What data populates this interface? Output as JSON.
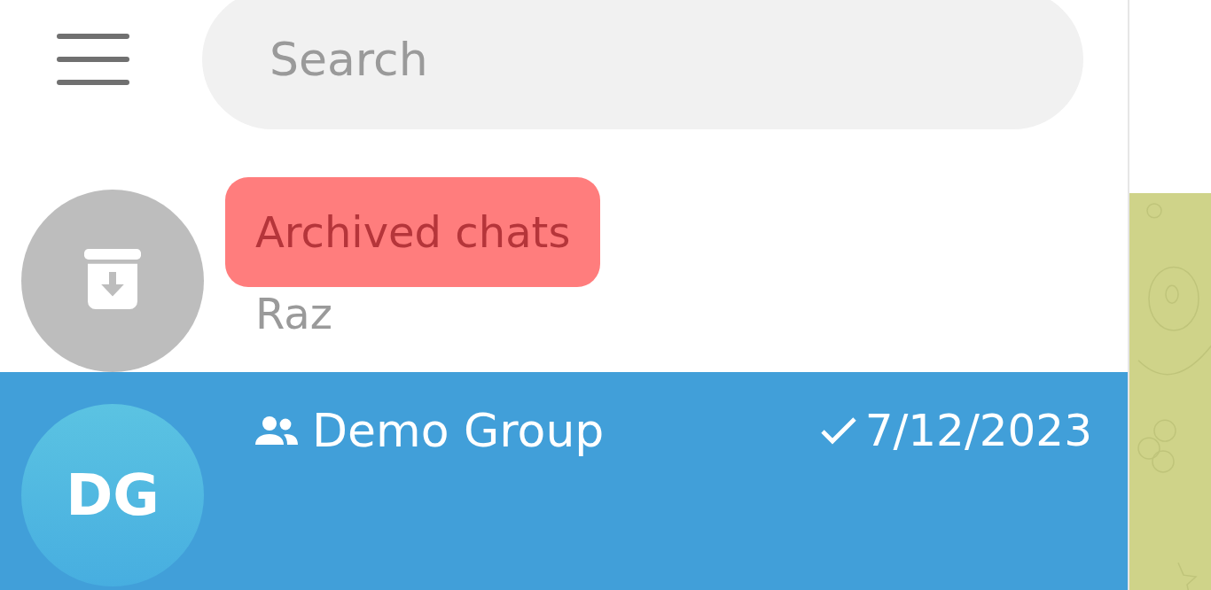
{
  "search": {
    "placeholder": "Search"
  },
  "chats": [
    {
      "kind": "archive",
      "title": "Archived chats",
      "highlighted": true,
      "preview": "Raz",
      "selected": false
    },
    {
      "kind": "group",
      "title": "Demo Group",
      "avatar": "DG",
      "date": "7/12/2023",
      "sent": true,
      "selected": true
    }
  ]
}
